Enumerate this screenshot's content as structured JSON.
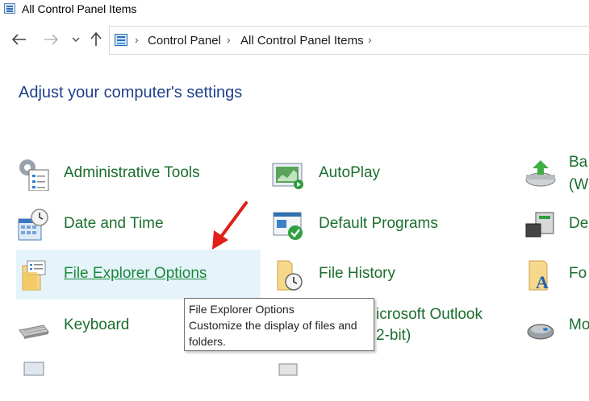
{
  "window": {
    "title": "All Control Panel Items"
  },
  "nav": {
    "back_icon": "arrow-left-icon",
    "forward_icon": "arrow-right-icon",
    "recent_icon": "chevron-down-icon",
    "up_icon": "arrow-up-icon"
  },
  "address": {
    "crumbs": [
      "Control Panel",
      "All Control Panel Items"
    ]
  },
  "heading": "Adjust your computer's settings",
  "items": [
    {
      "label": "Administrative Tools",
      "icon": "administrative-tools-icon"
    },
    {
      "label": "Date and Time",
      "icon": "date-time-icon"
    },
    {
      "label": "File Explorer Options",
      "icon": "folder-options-icon",
      "selected": true
    },
    {
      "label": "Keyboard",
      "icon": "keyboard-icon"
    },
    {
      "label": "AutoPlay",
      "icon": "autoplay-icon"
    },
    {
      "label": "Default Programs",
      "icon": "default-programs-icon"
    },
    {
      "label": "File History",
      "icon": "file-history-icon"
    },
    {
      "label": "icrosoft Outlook",
      "label2": "2-bit)",
      "icon": "outlook-icon"
    },
    {
      "label": "Ba",
      "label2": "(W",
      "icon": "backup-icon"
    },
    {
      "label": "De",
      "icon": "devices-icon"
    },
    {
      "label": "Fo",
      "icon": "fonts-icon"
    },
    {
      "label": "Mo",
      "icon": "mouse-icon"
    }
  ],
  "tooltip": {
    "title": "File Explorer Options",
    "line1": "Customize the display of files and",
    "line2": "folders."
  },
  "colors": {
    "link_green": "#1b6e2e",
    "heading_blue": "#1e3f8a",
    "selection": "#e5f3fb",
    "arrow_red": "#e0201b"
  }
}
